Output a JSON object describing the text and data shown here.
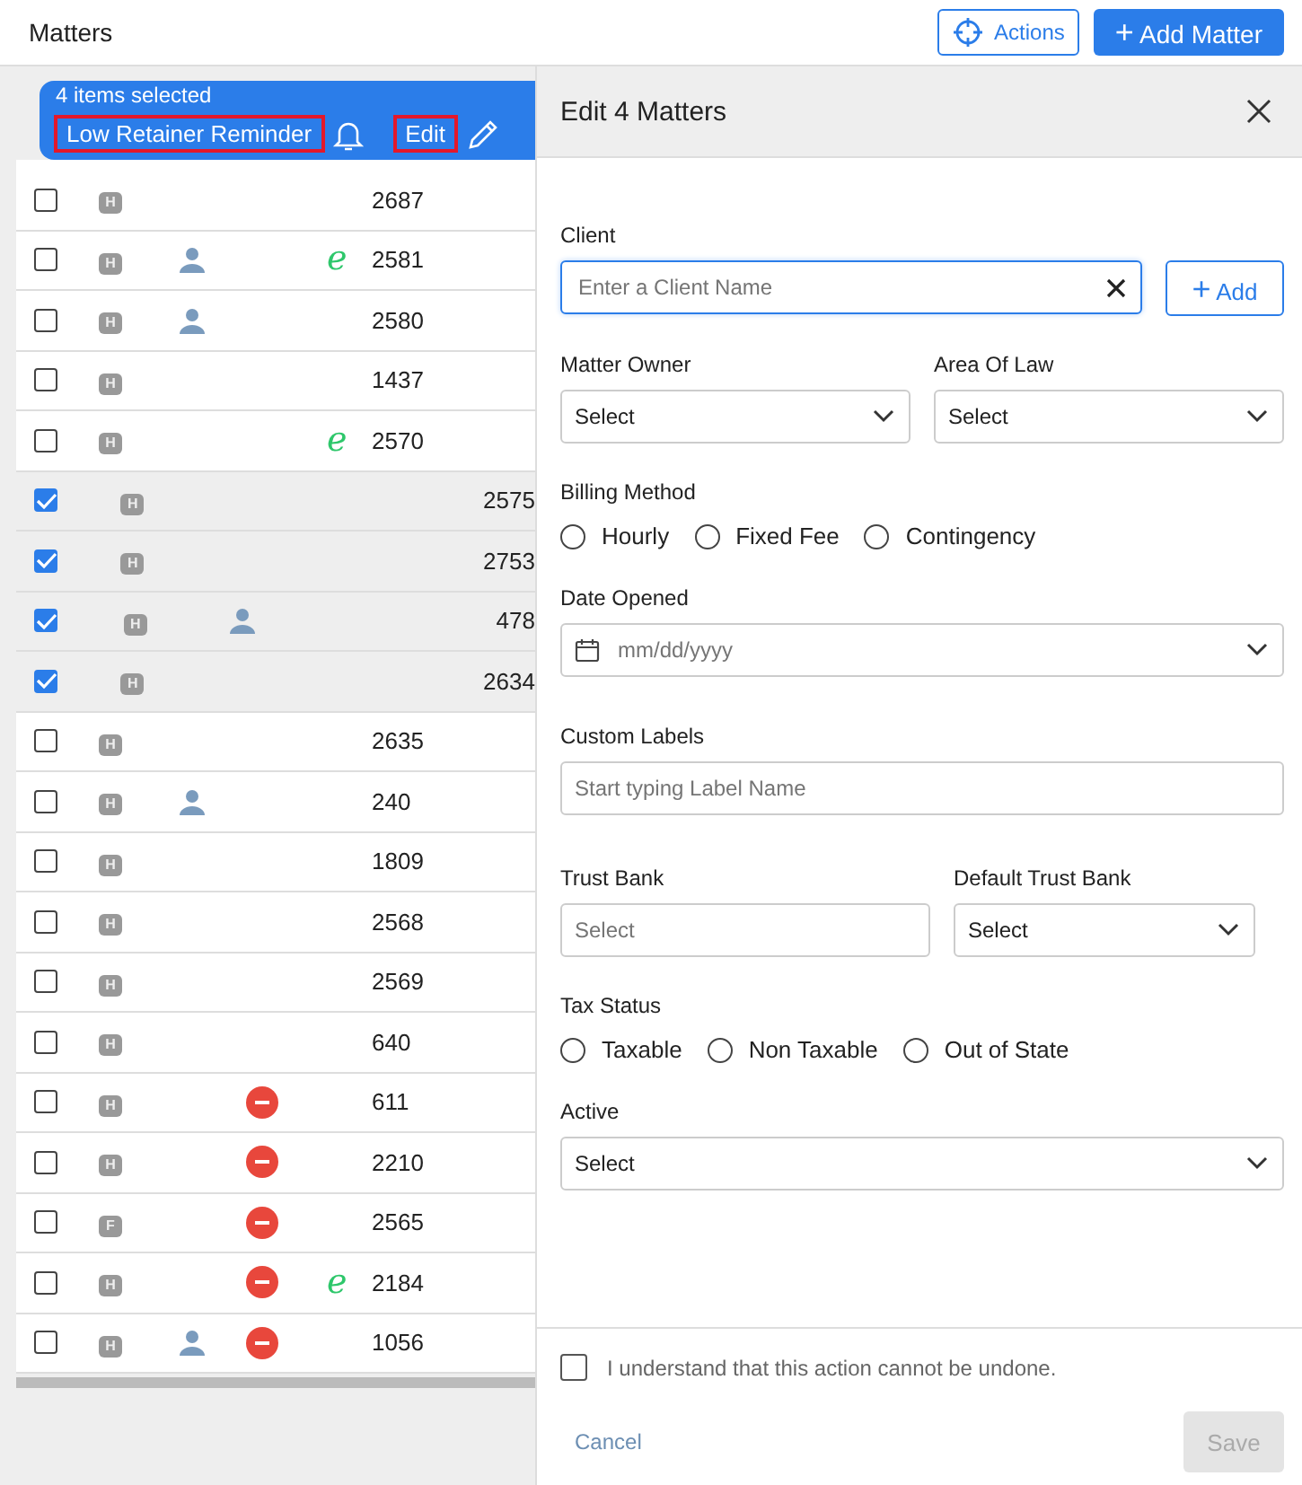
{
  "header": {
    "title": "Matters",
    "actions_button": "Actions",
    "add_button": "Add Matter",
    "add_icon": "+"
  },
  "selection_banner": {
    "count_text": "4 items selected",
    "actions": [
      {
        "label": "Low Retainer Reminder",
        "kind": "bell",
        "highlighted": true
      },
      {
        "label": "Edit",
        "kind": "pencil",
        "highlighted": true
      }
    ]
  },
  "rows": [
    {
      "checked": false,
      "badge": "H",
      "person": false,
      "blocked": false,
      "number": "2687"
    },
    {
      "checked": false,
      "badge": "H",
      "person": true,
      "blocked": false,
      "e_mark": "e",
      "number": "2581"
    },
    {
      "checked": false,
      "badge": "H",
      "person": true,
      "blocked": false,
      "number": "2580"
    },
    {
      "checked": false,
      "badge": "H",
      "person": false,
      "blocked": false,
      "number": "1437"
    },
    {
      "checked": false,
      "badge": "H",
      "person": false,
      "blocked": false,
      "e_mark": "e",
      "number": "2570"
    },
    {
      "checked": true,
      "badge": "H",
      "person": false,
      "blocked": false,
      "number": "2575"
    },
    {
      "checked": true,
      "badge": "H",
      "person": false,
      "blocked": false,
      "number": "2753"
    },
    {
      "checked": true,
      "badge": "H",
      "person": true,
      "blocked": false,
      "number": "478"
    },
    {
      "checked": true,
      "badge": "H",
      "person": false,
      "blocked": false,
      "number": "2634"
    },
    {
      "checked": false,
      "badge": "H",
      "person": false,
      "blocked": false,
      "number": "2635"
    },
    {
      "checked": false,
      "badge": "H",
      "person": true,
      "blocked": false,
      "number": "240"
    },
    {
      "checked": false,
      "badge": "H",
      "person": false,
      "blocked": false,
      "number": "1809"
    },
    {
      "checked": false,
      "badge": "H",
      "person": false,
      "blocked": false,
      "number": "2568"
    },
    {
      "checked": false,
      "badge": "H",
      "person": false,
      "blocked": false,
      "number": "2569"
    },
    {
      "checked": false,
      "badge": "H",
      "person": false,
      "blocked": false,
      "number": "640"
    },
    {
      "checked": false,
      "badge": "H",
      "person": false,
      "blocked": true,
      "number": "611"
    },
    {
      "checked": false,
      "badge": "H",
      "person": false,
      "blocked": true,
      "number": "2210"
    },
    {
      "checked": false,
      "badge": "F",
      "person": false,
      "blocked": true,
      "number": "2565"
    },
    {
      "checked": false,
      "badge": "H",
      "person": false,
      "blocked": true,
      "e_mark": "e",
      "number": "2184"
    },
    {
      "checked": false,
      "badge": "H",
      "person": true,
      "blocked": true,
      "number": "1056"
    }
  ],
  "edit_panel": {
    "title": "Edit 4 Matters",
    "client": {
      "label": "Client",
      "placeholder": "Enter a Client Name",
      "add_button": "Add",
      "add_icon": "+"
    },
    "matter_owner": {
      "label": "Matter Owner",
      "value": "Select"
    },
    "area_of_law": {
      "label": "Area Of Law",
      "value": "Select"
    },
    "billing_method": {
      "label": "Billing Method",
      "options": [
        {
          "label": "Hourly",
          "selected": false
        },
        {
          "label": "Fixed Fee",
          "selected": false
        },
        {
          "label": "Contingency",
          "selected": false
        }
      ]
    },
    "date_opened": {
      "label": "Date Opened",
      "placeholder": "mm/dd/yyyy"
    },
    "custom_labels": {
      "label": "Custom Labels",
      "placeholder": "Start typing Label Name"
    },
    "trust_bank": {
      "label": "Trust Bank",
      "placeholder": "Select"
    },
    "default_trust_bank": {
      "label": "Default Trust Bank",
      "value": "Select"
    },
    "tax_status": {
      "label": "Tax Status",
      "options": [
        {
          "label": "Taxable",
          "selected": false
        },
        {
          "label": "Non Taxable",
          "selected": false
        },
        {
          "label": "Out of State",
          "selected": false
        }
      ]
    },
    "active": {
      "label": "Active",
      "value": "Select"
    },
    "confirm": {
      "label": "I understand that this action cannot be undone.",
      "checked": false
    },
    "cancel_button": "Cancel",
    "save_button": "Save"
  }
}
